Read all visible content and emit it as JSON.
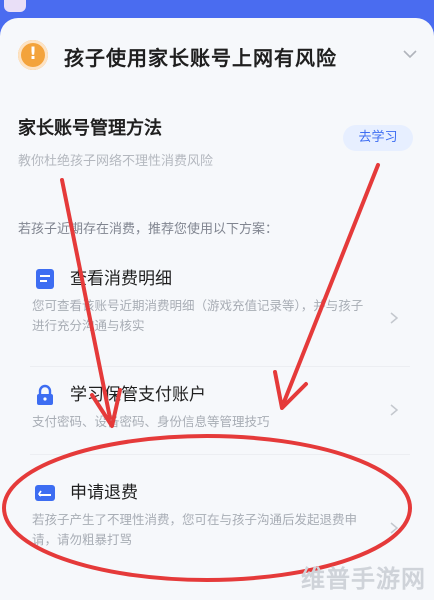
{
  "risk": {
    "title": "孩子使用家长账号上网有风险"
  },
  "management": {
    "title": "家长账号管理方法",
    "subtitle": "教你杜绝孩子网络不理性消费风险",
    "learn_button": "去学习"
  },
  "recommend": {
    "intro": "若孩子近期存在消费，推荐您使用以下方案："
  },
  "options": [
    {
      "title": "查看消费明细",
      "desc": "您可查看该账号近期消费明细（游戏充值记录等），并与孩子进行充分沟通与核实",
      "icon": "document-icon"
    },
    {
      "title": "学习保管支付账户",
      "desc": "支付密码、设备密码、身份信息等管理技巧",
      "icon": "lock-icon"
    },
    {
      "title": "申请退费",
      "desc": "若孩子产生了不理性消费，您可在与孩子沟通后发起退费申请，请勿粗暴打骂",
      "icon": "refund-card-icon"
    }
  ],
  "watermark": "维普手游网",
  "colors": {
    "accent": "#3d6df2",
    "annotation": "#e53a3a",
    "warning": "#f3a33c",
    "header": "#4a6cf0"
  }
}
